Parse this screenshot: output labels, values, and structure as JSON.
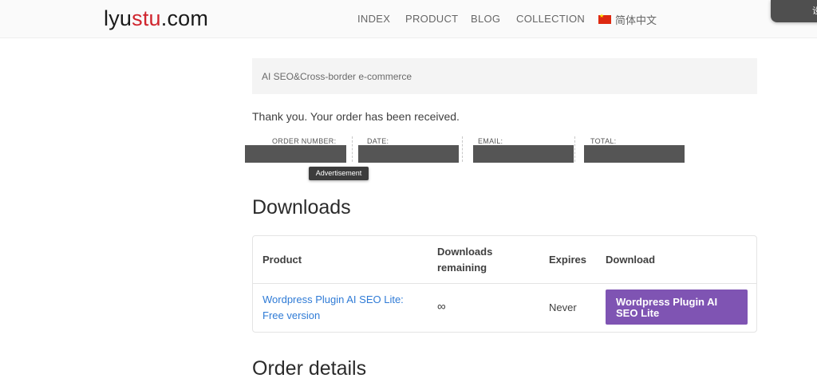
{
  "header": {
    "logo_text_1": "lyu",
    "logo_text_2": "stu",
    "logo_text_3": ".com",
    "nav": [
      "INDEX",
      "PRODUCT",
      "BLOG",
      "COLLECTION"
    ],
    "language": "简体中文",
    "language_flag": "china-flag-icon",
    "corner_tab_text": "设"
  },
  "breadcrumb": "AI SEO&Cross-border e-commerce",
  "confirmation": "Thank you. Your order has been received.",
  "order_overview": {
    "labels": [
      "ORDER NUMBER:",
      "DATE:",
      "EMAIL:",
      "TOTAL:"
    ]
  },
  "ad_tooltip": "Advertisement",
  "downloads": {
    "title": "Downloads",
    "headers": {
      "product": "Product",
      "remaining_1": "Downloads",
      "remaining_2": "remaining",
      "expires": "Expires",
      "download": "Download"
    },
    "row": {
      "product_1": "Wordpress Plugin AI SEO Lite:",
      "product_2": "Free version",
      "remaining": "∞",
      "expires": "Never",
      "button_1": "Wordpress Plugin AI",
      "button_2": "SEO Lite"
    }
  },
  "order_details_title": "Order details",
  "colors": {
    "accent_purple": "#7f54b3",
    "link_blue": "#2f7bd6",
    "logo_red": "#d0252e"
  }
}
